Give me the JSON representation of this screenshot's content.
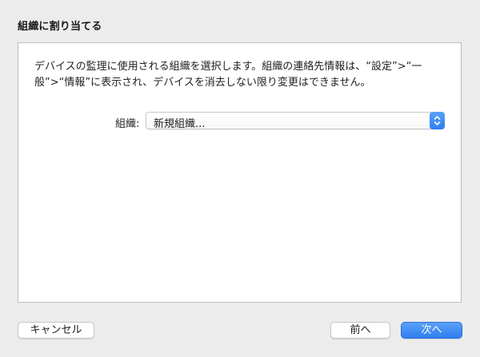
{
  "dialog": {
    "title": "組織に割り当てる",
    "description": "デバイスの監理に使用される組織を選択します。組織の連絡先情報は、“設定”>“一般”>“情報”に表示され、デバイスを消去しない限り変更はできません。"
  },
  "organization": {
    "label": "組織:",
    "selected": "新規組織..."
  },
  "buttons": {
    "cancel": "キャンセル",
    "back": "前へ",
    "next": "次へ"
  },
  "colors": {
    "accent": "#2f7ef0",
    "window_bg": "#ececec",
    "panel_bg": "#ffffff"
  },
  "icons": {
    "select_stepper": "chevron-up-down-icon"
  }
}
